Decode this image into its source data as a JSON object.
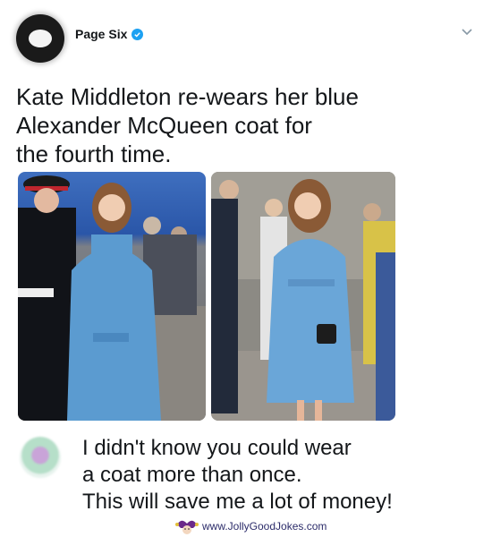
{
  "header": {
    "author": "Page Six"
  },
  "tweet": {
    "lines": [
      "Kate Middleton re-wears her blue",
      "Alexander McQueen coat for",
      "the fourth time."
    ]
  },
  "reply": {
    "lines": [
      "I didn't know you could wear",
      "a coat more than once.",
      "This will save me a lot of money!"
    ]
  },
  "watermark": {
    "text": "www.JollyGoodJokes.com"
  },
  "colors": {
    "verified": "#1da1f2",
    "coat": "#5b9bd0",
    "text": "#14171a"
  },
  "icons": {
    "verified": "verified-badge-icon",
    "menu": "chevron-down-icon"
  }
}
